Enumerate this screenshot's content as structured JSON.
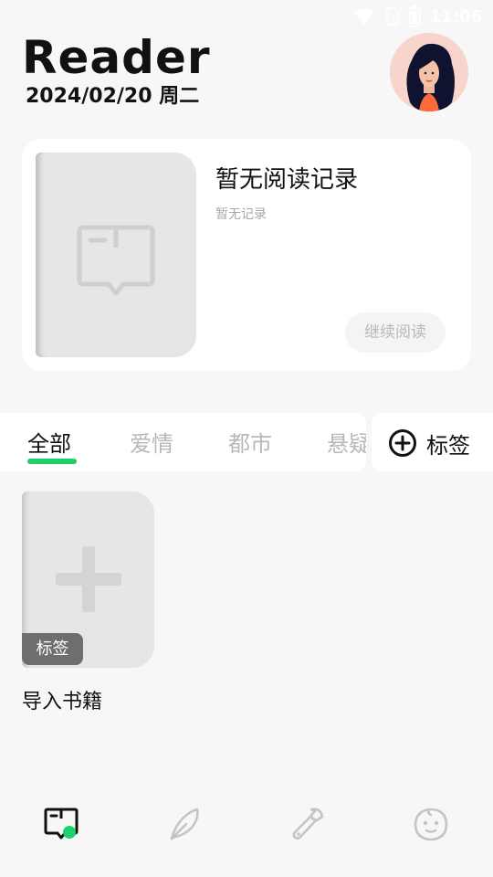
{
  "status_bar": {
    "time": "11:06"
  },
  "header": {
    "title": "Reader",
    "date": "2024/02/20 周二"
  },
  "recent": {
    "title": "暂无阅读记录",
    "subtitle": "暂无记录",
    "continue_label": "继续阅读"
  },
  "tabs": [
    {
      "label": "全部",
      "active": true
    },
    {
      "label": "爱情",
      "active": false
    },
    {
      "label": "都市",
      "active": false
    },
    {
      "label": "悬疑",
      "active": false
    }
  ],
  "tag_button": {
    "label": "标签",
    "icon": "plus-circle-icon"
  },
  "shelf": {
    "cover_tag": "标签",
    "import_label": "导入书籍"
  },
  "bottom_nav": [
    {
      "icon": "book-chat-icon",
      "active": true
    },
    {
      "icon": "feather-icon",
      "active": false
    },
    {
      "icon": "wrench-icon",
      "active": false
    },
    {
      "icon": "face-icon",
      "active": false
    }
  ],
  "colors": {
    "accent": "#1dd06b",
    "background": "#f7f7f7",
    "card": "#ffffff",
    "muted": "#b8b8b8"
  }
}
